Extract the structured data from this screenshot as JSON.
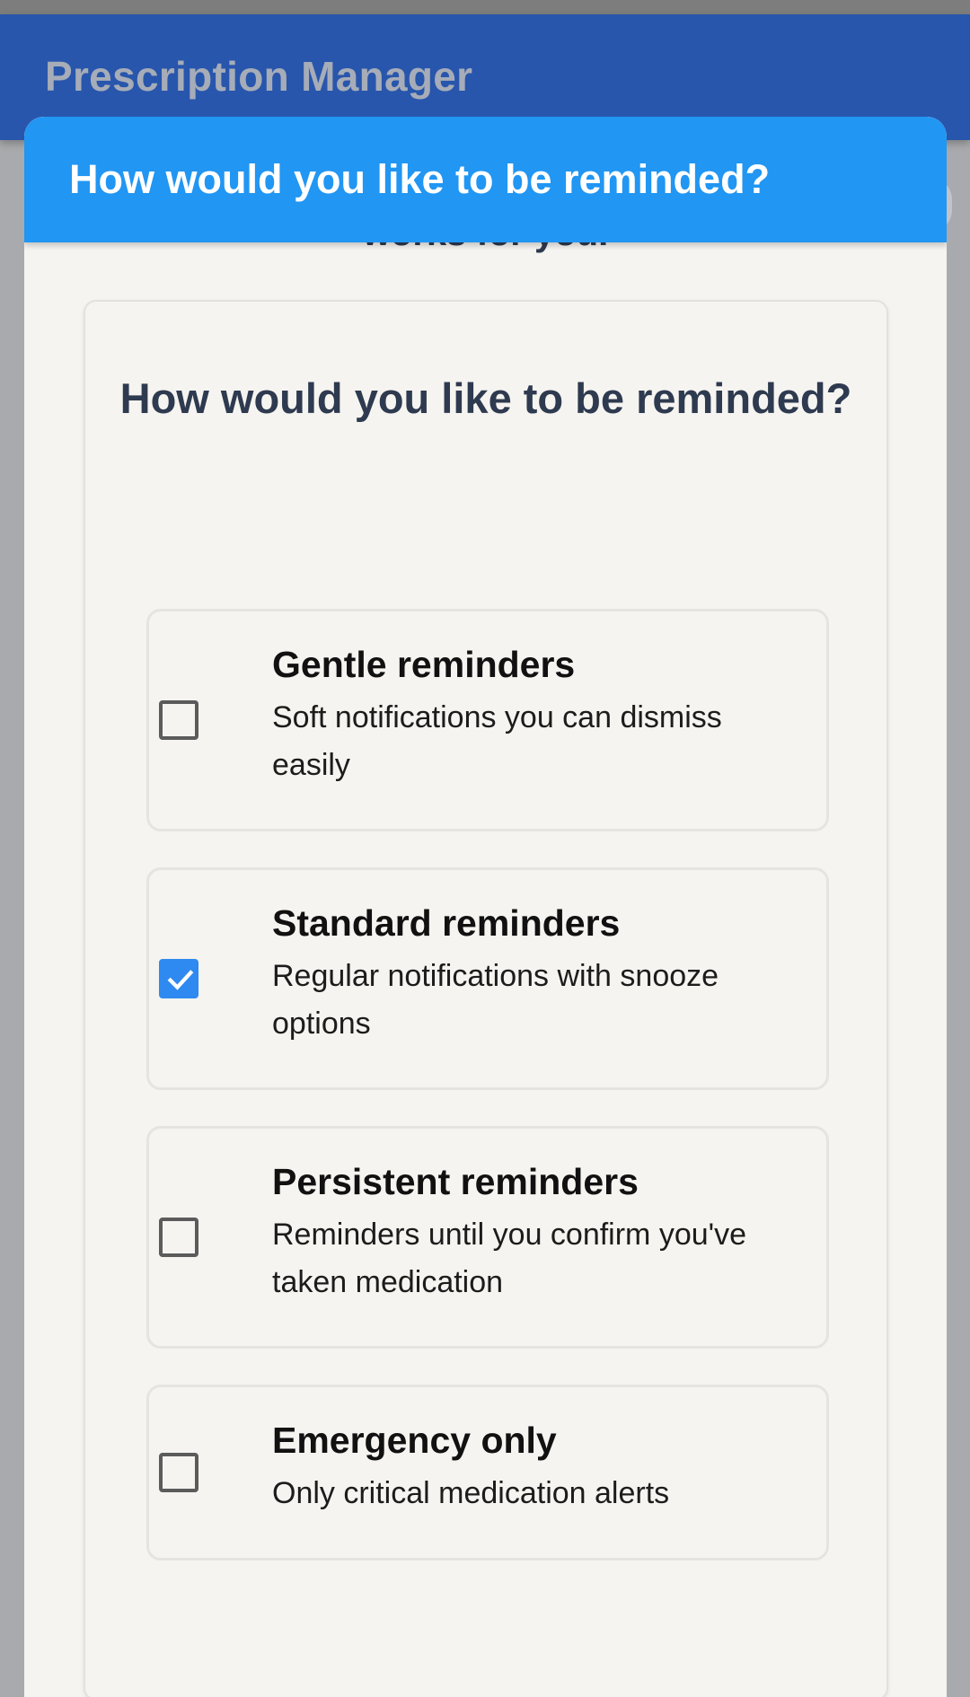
{
  "app_bar": {
    "title": "Prescription Manager"
  },
  "dialog": {
    "title": "How would you like to be reminded?",
    "behind_text": "works for you."
  },
  "card": {
    "question": "How would you like to be reminded?",
    "options": [
      {
        "title": "Gentle reminders",
        "description": "Soft notifications you can dismiss easily",
        "checked": false
      },
      {
        "title": "Standard reminders",
        "description": "Regular notifications with snooze options",
        "checked": true
      },
      {
        "title": "Persistent reminders",
        "description": "Reminders until you confirm you've taken medication",
        "checked": false
      },
      {
        "title": "Emergency only",
        "description": "Only critical medication alerts",
        "checked": false
      }
    ]
  },
  "colors": {
    "app_bar": "#2856ac",
    "dialog_header": "#2196f3",
    "checkbox_checked": "#2e8af0",
    "surface": "#f6f4f0"
  },
  "icons": {
    "checked": "check-icon"
  }
}
